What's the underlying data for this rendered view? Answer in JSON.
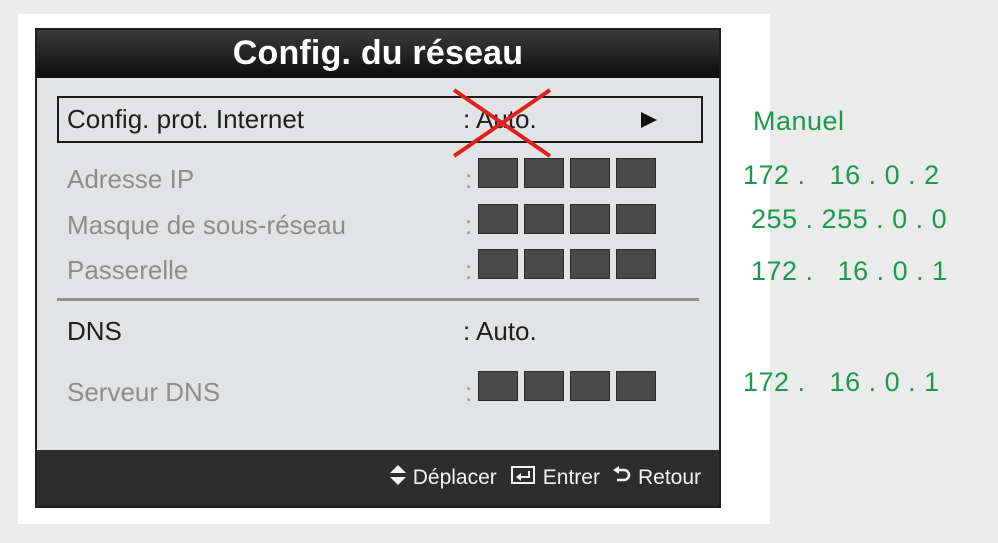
{
  "dialog": {
    "title": "Config. du réseau",
    "rows": [
      {
        "label": "Config. prot. Internet",
        "value": ": Auto."
      },
      {
        "label": "Adresse IP",
        "value": ":"
      },
      {
        "label": "Masque de sous-réseau",
        "value": ":"
      },
      {
        "label": "Passerelle",
        "value": ":"
      },
      {
        "label": "DNS",
        "value": ": Auto."
      },
      {
        "label": "Serveur DNS",
        "value": ":"
      }
    ],
    "footer": {
      "move_label": "Déplacer",
      "enter_label": "Entrer",
      "return_label": "Retour"
    }
  },
  "annotations": {
    "mode": "Manuel",
    "ip": "172 .   16 . 0 . 2",
    "mask": "255 . 255 . 0 . 0",
    "gateway": "172 .   16 . 0 . 1",
    "dns": "172 .   16 . 0 . 1",
    "color": "#1a9a4a"
  },
  "colors": {
    "cross": "#e0201b",
    "panel": "#e2e3e4",
    "title_bar": "#111111"
  }
}
